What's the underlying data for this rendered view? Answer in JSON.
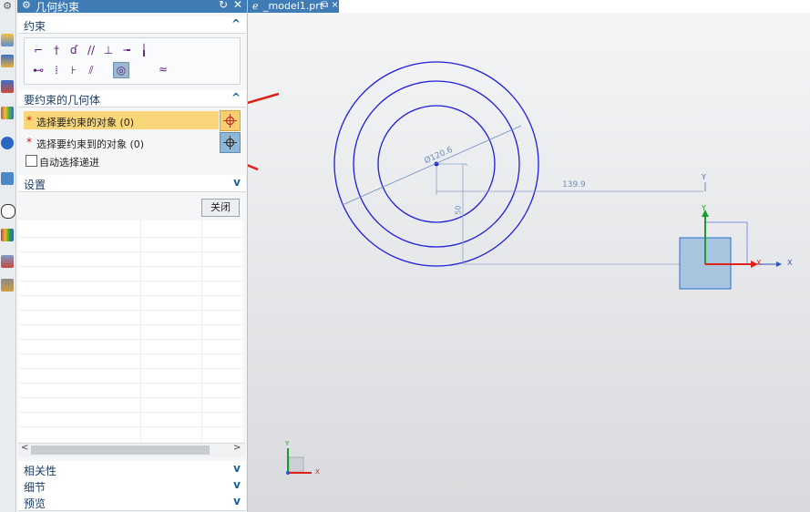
{
  "dialog": {
    "title": "几何约束",
    "sections": {
      "constraints": "约束",
      "geometry": "要约束的几何体",
      "settings": "设置",
      "relevance": "相关性",
      "details": "细节",
      "preview": "预览"
    },
    "rows": {
      "select_object": "选择要约束的对象 (0)",
      "select_target": "选择要约束到的对象 (0)",
      "auto_advance": "自动选择递进"
    },
    "close_label": "关闭"
  },
  "tab": {
    "name": "_model1.prt"
  },
  "sketch": {
    "circle_dim": "Ø120.6",
    "horizontal_dim": "139.9",
    "vertical_dim": "50",
    "axis_x": "X",
    "axis_y": "Y"
  },
  "colors": {
    "title_bar": "#3f7bb5",
    "highlight_row": "#f9d67a",
    "sketch_curve": "#1d1ddd",
    "annotation_arrow": "#e0201a"
  }
}
